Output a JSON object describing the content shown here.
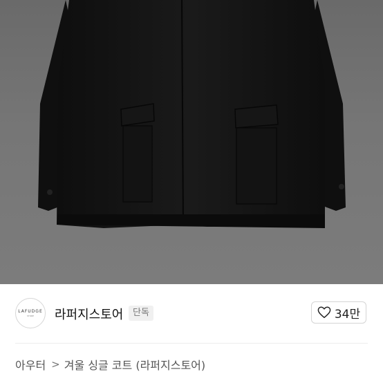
{
  "product_image": {
    "alt_icon": "product-photo-icon"
  },
  "store": {
    "avatar_logo_text": "LAFUDGE",
    "avatar_logo_sub": "STORE",
    "name": "라퍼지스토어",
    "badge": "단독"
  },
  "like": {
    "count": "34만",
    "icon": "heart-outline-icon"
  },
  "breadcrumb": {
    "category": "아우터",
    "separator": ">",
    "product": "겨울 싱글 코트 (라퍼지스토어)"
  },
  "colors": {
    "photo_bg": "#737373",
    "coat": "#121212",
    "badge_bg": "#f0f0f0"
  }
}
